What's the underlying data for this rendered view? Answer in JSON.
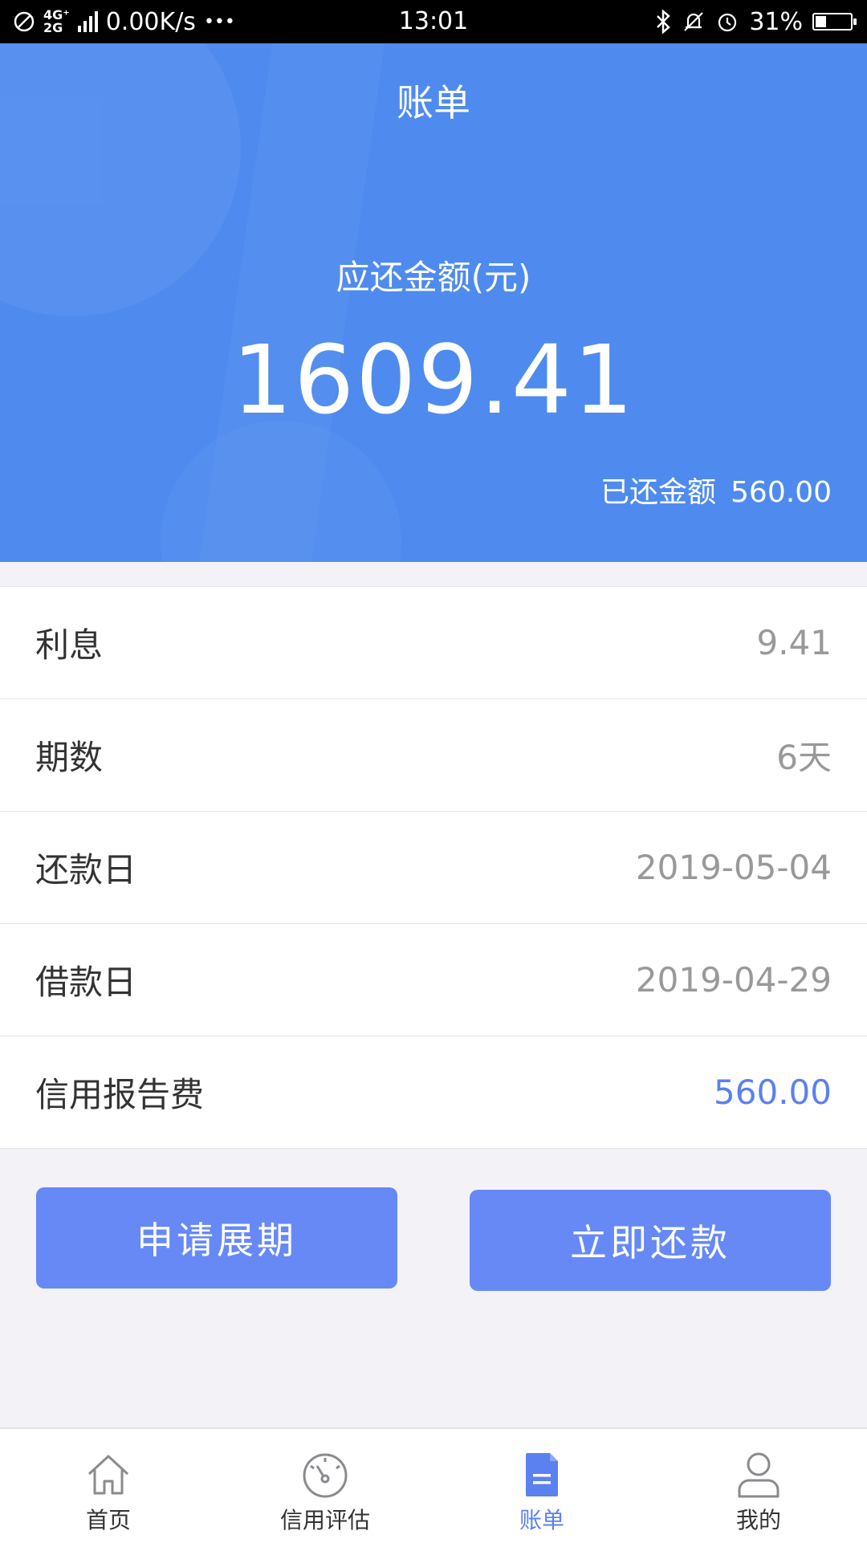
{
  "status_bar": {
    "network_label": "4G⁺",
    "network_label2": "2G",
    "speed": "0.00K/s",
    "dots": "•••",
    "time": "13:01",
    "battery_percent": "31%",
    "battery_level": 0.31
  },
  "header": {
    "title": "账单",
    "due_label": "应还金额(元)",
    "due_amount": "1609.41",
    "paid_label": "已还金额",
    "paid_amount": "560.00",
    "background_color": "#4f8bee"
  },
  "details": [
    {
      "label": "利息",
      "value": "9.41"
    },
    {
      "label": "期数",
      "value": "6天"
    },
    {
      "label": "还款日",
      "value": "2019-05-04"
    },
    {
      "label": "借款日",
      "value": "2019-04-29"
    },
    {
      "label": "信用报告费",
      "value": "560.00"
    }
  ],
  "buttons": {
    "extend": "申请展期",
    "repay": "立即还款",
    "color": "#6689f6"
  },
  "tabbar": {
    "items": [
      {
        "label": "首页",
        "icon": "home-icon"
      },
      {
        "label": "信用评估",
        "icon": "gauge-icon"
      },
      {
        "label": "账单",
        "icon": "bill-icon",
        "active": true
      },
      {
        "label": "我的",
        "icon": "user-icon"
      }
    ],
    "active_color": "#5b80f0"
  }
}
